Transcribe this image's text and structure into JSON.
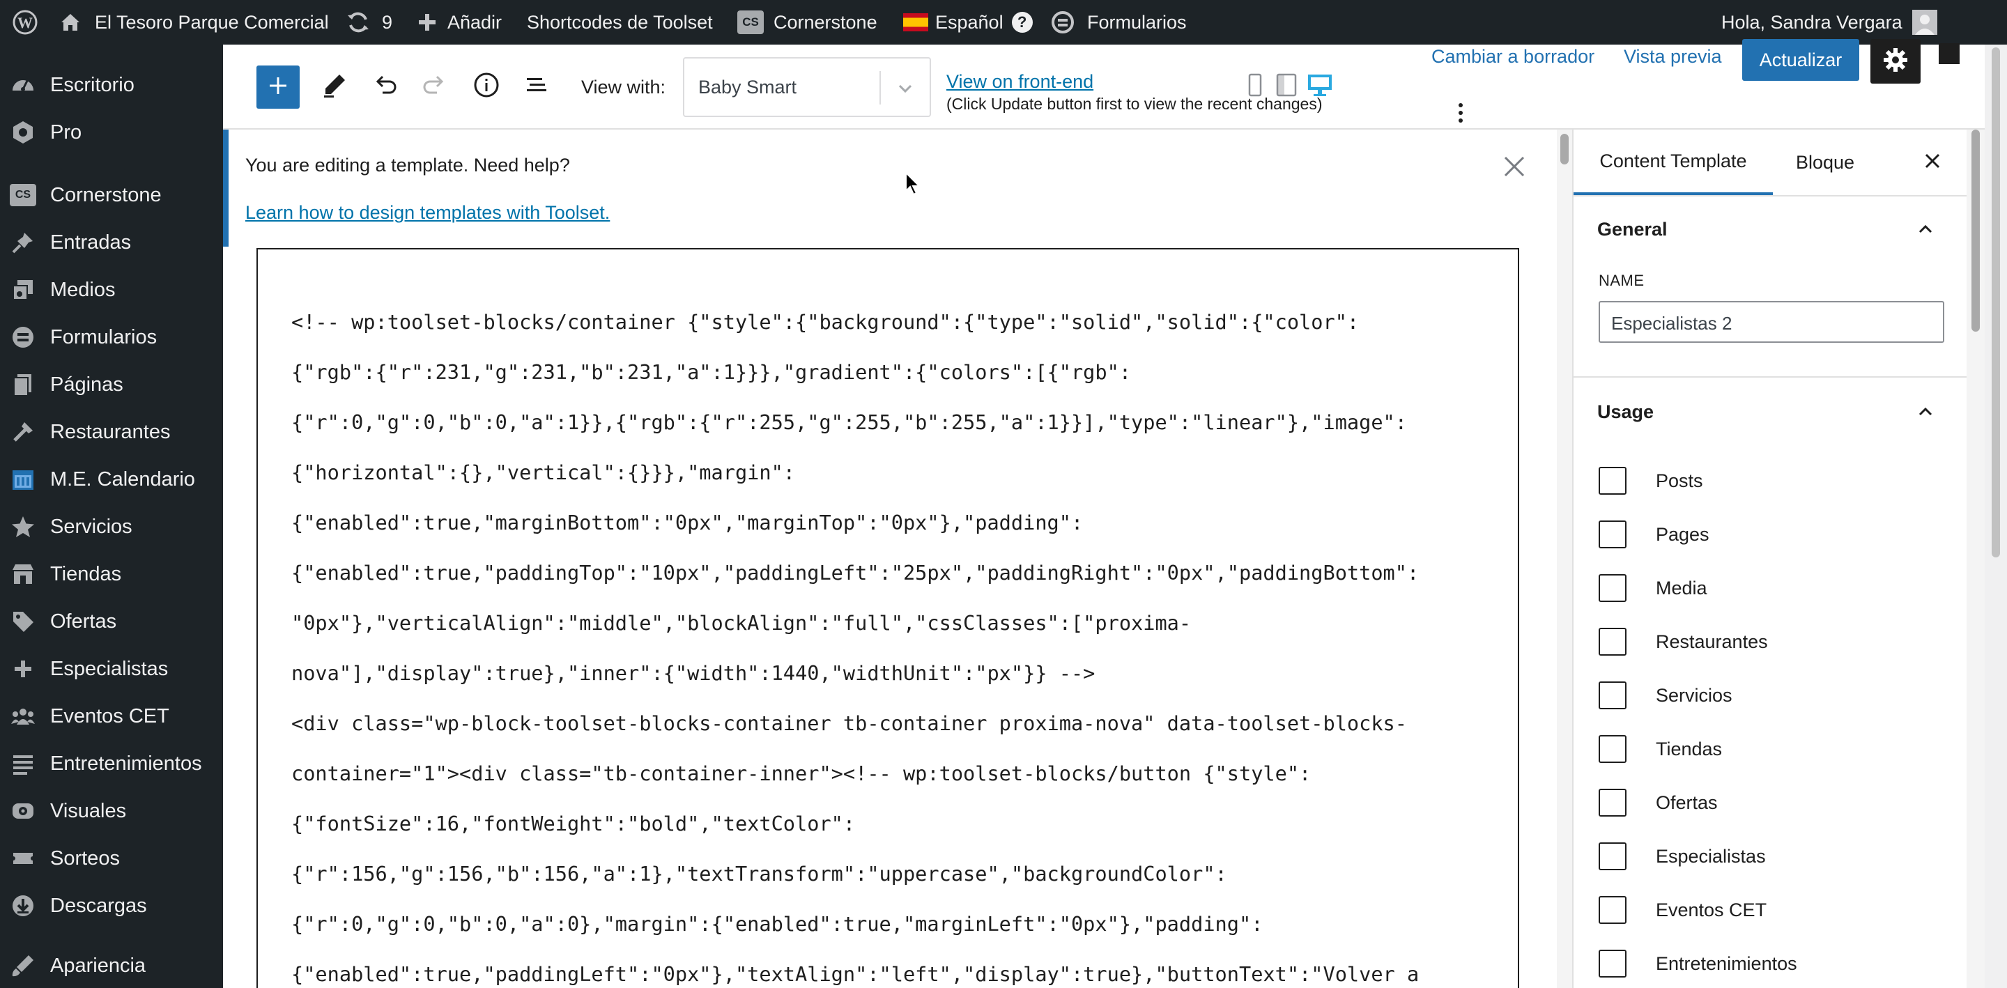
{
  "adminbar": {
    "site_name": "El Tesoro Parque Comercial",
    "updates_count": "9",
    "add_new": "Añadir",
    "toolset_shortcodes": "Shortcodes de Toolset",
    "cornerstone": "Cornerstone",
    "cornerstone_badge": "CS",
    "language": "Español",
    "help_glyph": "?",
    "forms": "Formularios",
    "greeting": "Hola, Sandra Vergara"
  },
  "sidebar": {
    "items": [
      {
        "label": "Escritorio",
        "icon": "dashboard-icon"
      },
      {
        "label": "Pro",
        "icon": "pro-icon"
      },
      {
        "label": "Cornerstone",
        "icon": "cornerstone-icon"
      },
      {
        "label": "Entradas",
        "icon": "pin-icon"
      },
      {
        "label": "Medios",
        "icon": "media-icon"
      },
      {
        "label": "Formularios",
        "icon": "forms-icon"
      },
      {
        "label": "Páginas",
        "icon": "pages-icon"
      },
      {
        "label": "Restaurantes",
        "icon": "restaurant-icon"
      },
      {
        "label": "M.E. Calendario",
        "icon": "calendar-icon"
      },
      {
        "label": "Servicios",
        "icon": "star-icon"
      },
      {
        "label": "Tiendas",
        "icon": "store-icon"
      },
      {
        "label": "Ofertas",
        "icon": "tag-icon"
      },
      {
        "label": "Especialistas",
        "icon": "plus-icon"
      },
      {
        "label": "Eventos CET",
        "icon": "groups-icon"
      },
      {
        "label": "Entretenimientos",
        "icon": "list-icon"
      },
      {
        "label": "Visuales",
        "icon": "visibility-icon"
      },
      {
        "label": "Sorteos",
        "icon": "tickets-icon"
      },
      {
        "label": "Descargas",
        "icon": "download-icon"
      },
      {
        "label": "Apariencia",
        "icon": "appearance-icon"
      }
    ]
  },
  "toolbar": {
    "view_with_label": "View with:",
    "view_with_value": "Baby Smart",
    "front_end_link": "View on front-end",
    "front_end_hint": "(Click Update button first to view the recent changes)",
    "switch_to_draft": "Cambiar a borrador",
    "preview": "Vista previa",
    "update": "Actualizar"
  },
  "notice": {
    "text": "You are editing a template. Need help?",
    "link": "Learn how to design templates with Toolset."
  },
  "code_lines": [
    "<!-- wp:toolset-blocks/container {\"style\":{\"background\":{\"type\":\"solid\",\"solid\":{\"color\":",
    "{\"rgb\":{\"r\":231,\"g\":231,\"b\":231,\"a\":1}}},\"gradient\":{\"colors\":[{\"rgb\":",
    "{\"r\":0,\"g\":0,\"b\":0,\"a\":1}},{\"rgb\":{\"r\":255,\"g\":255,\"b\":255,\"a\":1}}],\"type\":\"linear\"},\"image\":",
    "{\"horizontal\":{},\"vertical\":{}}},\"margin\":",
    "{\"enabled\":true,\"marginBottom\":\"0px\",\"marginTop\":\"0px\"},\"padding\":",
    "{\"enabled\":true,\"paddingTop\":\"10px\",\"paddingLeft\":\"25px\",\"paddingRight\":\"0px\",\"paddingBottom\":",
    "\"0px\"},\"verticalAlign\":\"middle\",\"blockAlign\":\"full\",\"cssClasses\":[\"proxima-",
    "nova\"],\"display\":true},\"inner\":{\"width\":1440,\"widthUnit\":\"px\"}} -->",
    "<div class=\"wp-block-toolset-blocks-container tb-container proxima-nova\" data-toolset-blocks-",
    "container=\"1\"><div class=\"tb-container-inner\"><!-- wp:toolset-blocks/button {\"style\":",
    "{\"fontSize\":16,\"fontWeight\":\"bold\",\"textColor\":",
    "{\"r\":156,\"g\":156,\"b\":156,\"a\":1},\"textTransform\":\"uppercase\",\"backgroundColor\":",
    "{\"r\":0,\"g\":0,\"b\":0,\"a\":0},\"margin\":{\"enabled\":true,\"marginLeft\":\"0px\"},\"padding\":",
    "{\"enabled\":true,\"paddingLeft\":\"0px\"},\"textAlign\":\"left\",\"display\":true},\"buttonText\":\"Volver a"
  ],
  "panel": {
    "tab_template": "Content Template",
    "tab_block": "Bloque",
    "general_title": "General",
    "name_label": "NAME",
    "name_value": "Especialistas 2",
    "usage_title": "Usage",
    "usage_items": [
      "Posts",
      "Pages",
      "Media",
      "Restaurantes",
      "Servicios",
      "Tiendas",
      "Ofertas",
      "Especialistas",
      "Eventos CET",
      "Entretenimientos"
    ]
  },
  "colors": {
    "admin_dark": "#1d2327",
    "accent": "#2271b1",
    "link": "#0073aa"
  }
}
